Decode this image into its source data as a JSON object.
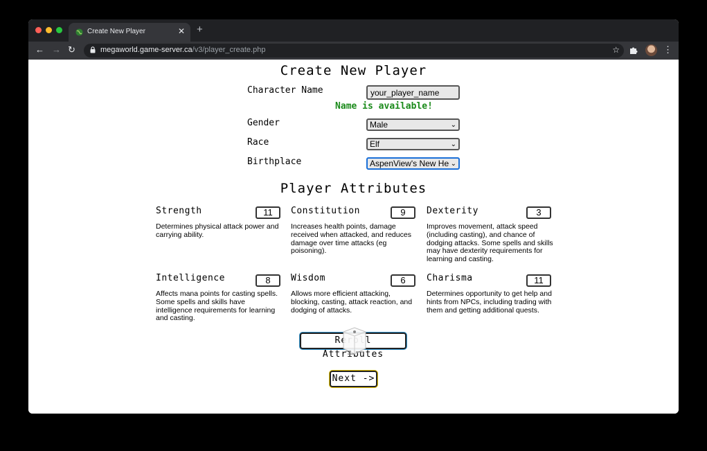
{
  "browser": {
    "tab_title": "Create New Player",
    "url_host": "megaworld.game-server.ca",
    "url_path": "/v3/player_create.php"
  },
  "page": {
    "title": "Create New Player",
    "character_name_label": "Character Name",
    "character_name_value": "your_player_name",
    "name_status": "Name is available!",
    "gender_label": "Gender",
    "gender_value": "Male",
    "race_label": "Race",
    "race_value": "Elf",
    "birthplace_label": "Birthplace",
    "birthplace_value": "AspenView's New Hero",
    "attributes_title": "Player Attributes",
    "status_color": "#1a8a1a"
  },
  "attributes": [
    {
      "name": "Strength",
      "value": "11",
      "desc": "Determines physical attack power and carrying ability."
    },
    {
      "name": "Constitution",
      "value": "9",
      "desc": "Increases health points, damage received when attacked, and reduces damage over time attacks (eg poisoning)."
    },
    {
      "name": "Dexterity",
      "value": "3",
      "desc": "Improves movement, attack speed (including casting), and chance of dodging attacks. Some spells and skills may have dexterity requirements for learning and casting."
    },
    {
      "name": "Intelligence",
      "value": "8",
      "desc": "Affects mana points for casting spells. Some spells and skills have intelligence requirements for learning and casting."
    },
    {
      "name": "Wisdom",
      "value": "6",
      "desc": "Allows more efficient attacking, blocking, casting, attack reaction, and dodging of attacks."
    },
    {
      "name": "Charisma",
      "value": "11",
      "desc": "Determines opportunity to get help and hints from NPCs, including trading with them and getting additional quests."
    }
  ],
  "buttons": {
    "reroll": "Reroll Attributes",
    "next": "Next ->"
  },
  "icons": {
    "favicon": "globe-icon",
    "dice": "dice-icon"
  }
}
